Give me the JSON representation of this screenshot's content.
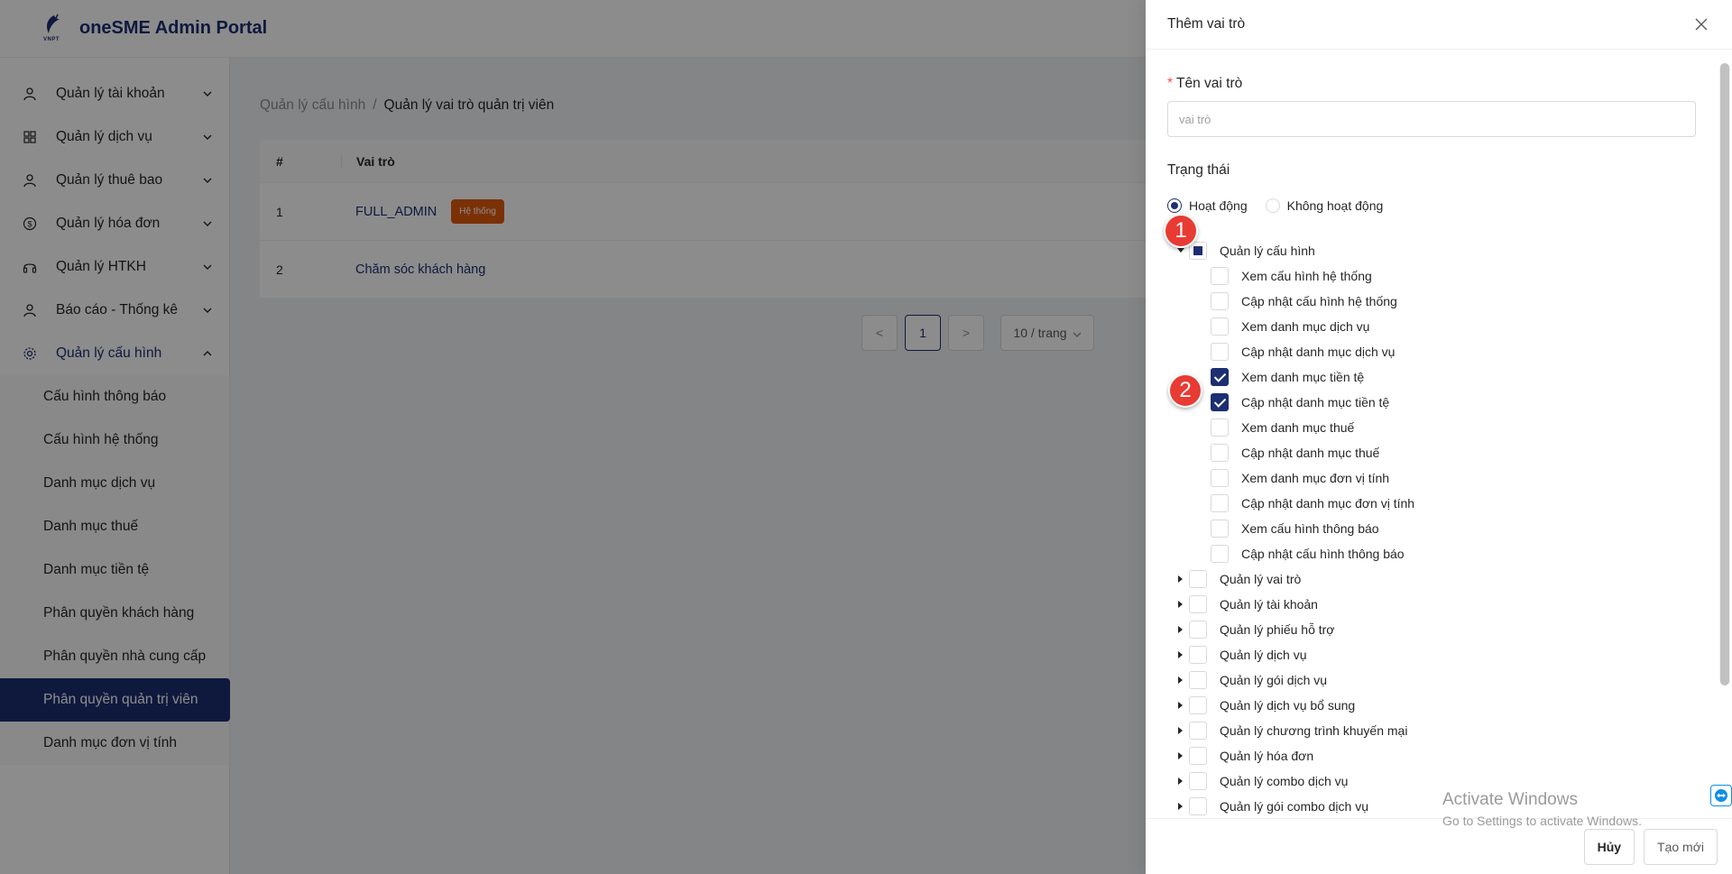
{
  "app": {
    "title": "oneSME Admin Portal",
    "logo_sub": "VNPT"
  },
  "sidebar": {
    "items": [
      {
        "label": "Quản lý tài khoản",
        "icon": "user-icon"
      },
      {
        "label": "Quản lý dịch vụ",
        "icon": "grid-icon"
      },
      {
        "label": "Quản lý thuê bao",
        "icon": "user-icon"
      },
      {
        "label": "Quản lý hóa đơn",
        "icon": "dollar-icon"
      },
      {
        "label": "Quản lý HTKH",
        "icon": "headset-icon"
      },
      {
        "label": "Báo cáo - Thống kê",
        "icon": "user-icon"
      },
      {
        "label": "Quản lý cấu hình",
        "icon": "gear-icon"
      }
    ],
    "subitems": [
      {
        "label": "Cấu hình thông báo"
      },
      {
        "label": "Cấu hình hệ thống"
      },
      {
        "label": "Danh mục dịch vụ"
      },
      {
        "label": "Danh mục thuế"
      },
      {
        "label": "Danh mục tiền tệ"
      },
      {
        "label": "Phân quyền khách hàng"
      },
      {
        "label": "Phân quyền nhà cung cấp"
      },
      {
        "label": "Phân quyền quản trị viên",
        "active": true
      },
      {
        "label": "Danh mục đơn vị tính"
      }
    ]
  },
  "breadcrumb": {
    "parent": "Quản lý cấu hình",
    "separator": "/",
    "current": "Quản lý vai trò quản trị viên"
  },
  "table": {
    "headers": {
      "num": "#",
      "role": "Vai trò"
    },
    "rows": [
      {
        "num": "1",
        "role": "FULL_ADMIN",
        "badge": "Hệ thống"
      },
      {
        "num": "2",
        "role": "Chăm sóc khách hàng"
      }
    ]
  },
  "pagination": {
    "prev": "<",
    "current": "1",
    "next": ">",
    "page_size": "10 / trang"
  },
  "drawer": {
    "title": "Thêm vai trò",
    "name_label": "Tên vai trò",
    "name_required": "*",
    "name_placeholder": "vai trò",
    "name_value": "",
    "status_label": "Trạng thái",
    "status_options": [
      {
        "label": "Hoạt động",
        "checked": true
      },
      {
        "label": "Không hoạt động",
        "checked": false
      }
    ],
    "tree": [
      {
        "label": "Quản lý cấu hình",
        "level": 0,
        "expanded": true,
        "state": "indeterminate"
      },
      {
        "label": "Xem cấu hình hệ thống",
        "level": 1,
        "state": "unchecked"
      },
      {
        "label": "Cập nhật cấu hình hệ thống",
        "level": 1,
        "state": "unchecked"
      },
      {
        "label": "Xem danh mục dịch vụ",
        "level": 1,
        "state": "unchecked"
      },
      {
        "label": "Cập nhật danh mục dịch vụ",
        "level": 1,
        "state": "unchecked"
      },
      {
        "label": "Xem danh mục tiền tệ",
        "level": 1,
        "state": "checked"
      },
      {
        "label": "Cập nhật danh mục tiền tệ",
        "level": 1,
        "state": "checked"
      },
      {
        "label": "Xem danh mục thuế",
        "level": 1,
        "state": "unchecked"
      },
      {
        "label": "Cập nhật danh mục thuế",
        "level": 1,
        "state": "unchecked"
      },
      {
        "label": "Xem danh mục đơn vị tính",
        "level": 1,
        "state": "unchecked"
      },
      {
        "label": "Cập nhật danh mục đơn vị tính",
        "level": 1,
        "state": "unchecked"
      },
      {
        "label": "Xem cấu hình thông báo",
        "level": 1,
        "state": "unchecked"
      },
      {
        "label": "Cập nhật cấu hình thông báo",
        "level": 1,
        "state": "unchecked"
      },
      {
        "label": "Quản lý vai trò",
        "level": 0,
        "expanded": false,
        "state": "unchecked"
      },
      {
        "label": "Quản lý tài khoản",
        "level": 0,
        "expanded": false,
        "state": "unchecked"
      },
      {
        "label": "Quản lý phiếu hỗ trợ",
        "level": 0,
        "expanded": false,
        "state": "unchecked"
      },
      {
        "label": "Quản lý dịch vụ",
        "level": 0,
        "expanded": false,
        "state": "unchecked"
      },
      {
        "label": "Quản lý gói dịch vụ",
        "level": 0,
        "expanded": false,
        "state": "unchecked"
      },
      {
        "label": "Quản lý dịch vụ bổ sung",
        "level": 0,
        "expanded": false,
        "state": "unchecked"
      },
      {
        "label": "Quản lý chương trình khuyến mại",
        "level": 0,
        "expanded": false,
        "state": "unchecked"
      },
      {
        "label": "Quản lý hóa đơn",
        "level": 0,
        "expanded": false,
        "state": "unchecked"
      },
      {
        "label": "Quản lý combo dịch vụ",
        "level": 0,
        "expanded": false,
        "state": "unchecked"
      },
      {
        "label": "Quản lý gói combo dịch vụ",
        "level": 0,
        "expanded": false,
        "state": "unchecked"
      }
    ],
    "buttons": {
      "cancel": "Hủy",
      "create": "Tạo mới"
    }
  },
  "annotations": {
    "step1": "1",
    "step2": "2"
  },
  "watermark": {
    "line1": "Activate Windows",
    "line2": "Go to Settings to activate Windows."
  },
  "colors": {
    "brand": "#1c2f72",
    "badge": "#e05a0b",
    "annotation": "#e83b33",
    "required": "#ff4d4f"
  }
}
